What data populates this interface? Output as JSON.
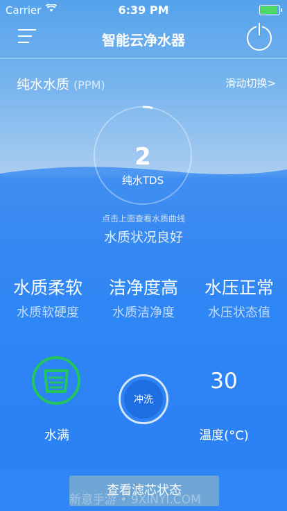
{
  "status_bar": {
    "carrier": "Carrier",
    "time": "6:39 PM"
  },
  "nav": {
    "title": "智能云净水器"
  },
  "quality": {
    "label": "纯水水质",
    "unit": "(PPM)",
    "switch_link": "滑动切换>"
  },
  "gauge": {
    "value": "2",
    "unit": "纯水TDS",
    "hint": "点击上面查看水质曲线",
    "status": "水质状况良好"
  },
  "stats": [
    {
      "value": "水质柔软",
      "label": "水质软硬度"
    },
    {
      "value": "洁净度高",
      "label": "水质洁净度"
    },
    {
      "value": "水压正常",
      "label": "水压状态值"
    }
  ],
  "tank": {
    "label": "水满"
  },
  "flush": {
    "label": "冲洗"
  },
  "temperature": {
    "value": "30",
    "label": "温度(°C)"
  },
  "filter_button": {
    "label": "查看滤芯状态"
  },
  "watermark": "新意手游 • 9XINYI.COM",
  "colors": {
    "background": "#2f86f5",
    "tank_icon": "#22c55e",
    "battery": "#4cd964"
  },
  "icons": {
    "menu": "hamburger-menu-icon",
    "power": "power-icon",
    "wifi": "wifi-icon",
    "battery": "battery-icon",
    "tank": "water-tank-icon"
  }
}
